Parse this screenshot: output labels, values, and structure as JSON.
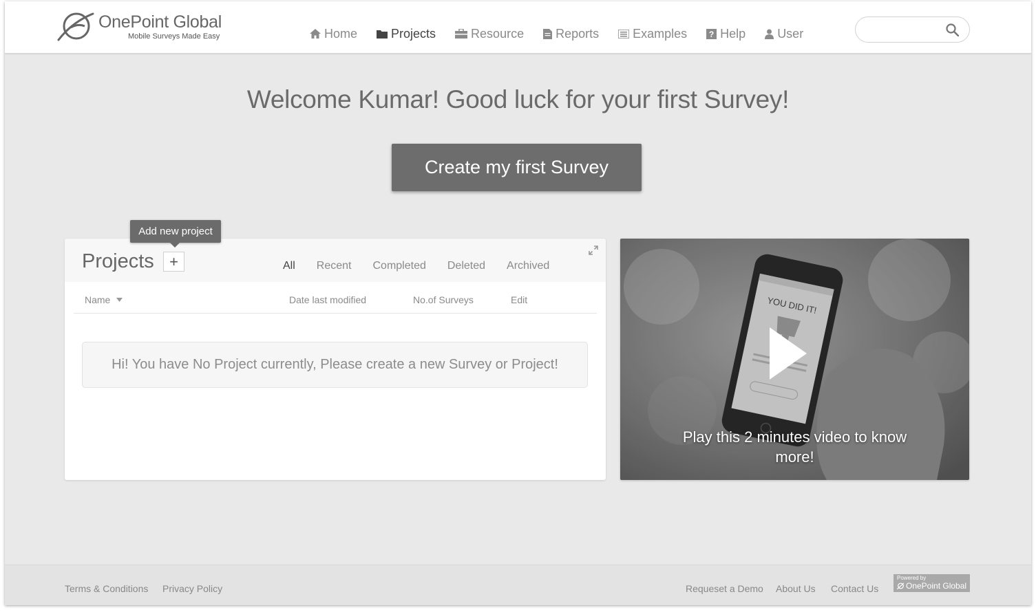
{
  "brand": {
    "name": "OnePoint Global",
    "tagline": "Mobile Surveys Made Easy",
    "logo_icon": "onepoint-logo-icon"
  },
  "nav": {
    "items": [
      {
        "label": "Home",
        "icon": "home-icon",
        "active": false
      },
      {
        "label": "Projects",
        "icon": "folder-icon",
        "active": true
      },
      {
        "label": "Resource",
        "icon": "briefcase-icon",
        "active": false
      },
      {
        "label": "Reports",
        "icon": "document-icon",
        "active": false
      },
      {
        "label": "Examples",
        "icon": "list-icon",
        "active": false
      },
      {
        "label": "Help",
        "icon": "help-icon",
        "active": false
      },
      {
        "label": "User",
        "icon": "user-icon",
        "active": false
      }
    ]
  },
  "search": {
    "value": "",
    "placeholder": "",
    "icon": "search-icon"
  },
  "welcome": {
    "title": "Welcome Kumar! Good luck for your first Survey!",
    "cta_label": "Create my first Survey"
  },
  "tooltip": {
    "text": "Add new project"
  },
  "projects": {
    "title": "Projects",
    "add_symbol": "+",
    "tabs": [
      {
        "label": "All",
        "active": true
      },
      {
        "label": "Recent",
        "active": false
      },
      {
        "label": "Completed",
        "active": false
      },
      {
        "label": "Deleted",
        "active": false
      },
      {
        "label": "Archived",
        "active": false
      }
    ],
    "columns": {
      "name": "Name",
      "date": "Date last modified",
      "surveys": "No.of Surveys",
      "edit": "Edit"
    },
    "empty_message": "Hi! You have No Project currently, Please create a new Survey or Project!"
  },
  "video": {
    "caption": "Play this 2 minutes video to know more!",
    "screen_text": "YOU DID IT!"
  },
  "footer": {
    "terms": "Terms & Conditions",
    "privacy": "Privacy Policy",
    "demo": "Requeset a Demo",
    "about": "About Us",
    "contact": "Contact Us",
    "powered_small": "Powered by",
    "powered_brand": "OnePoint Global"
  },
  "colors": {
    "header_bg": "#ffffff",
    "page_bg": "#e9e9e9",
    "cta_bg": "#6d6d6d",
    "tooltip_bg": "#6b6b6b",
    "footer_bg": "#e3e3e3"
  }
}
